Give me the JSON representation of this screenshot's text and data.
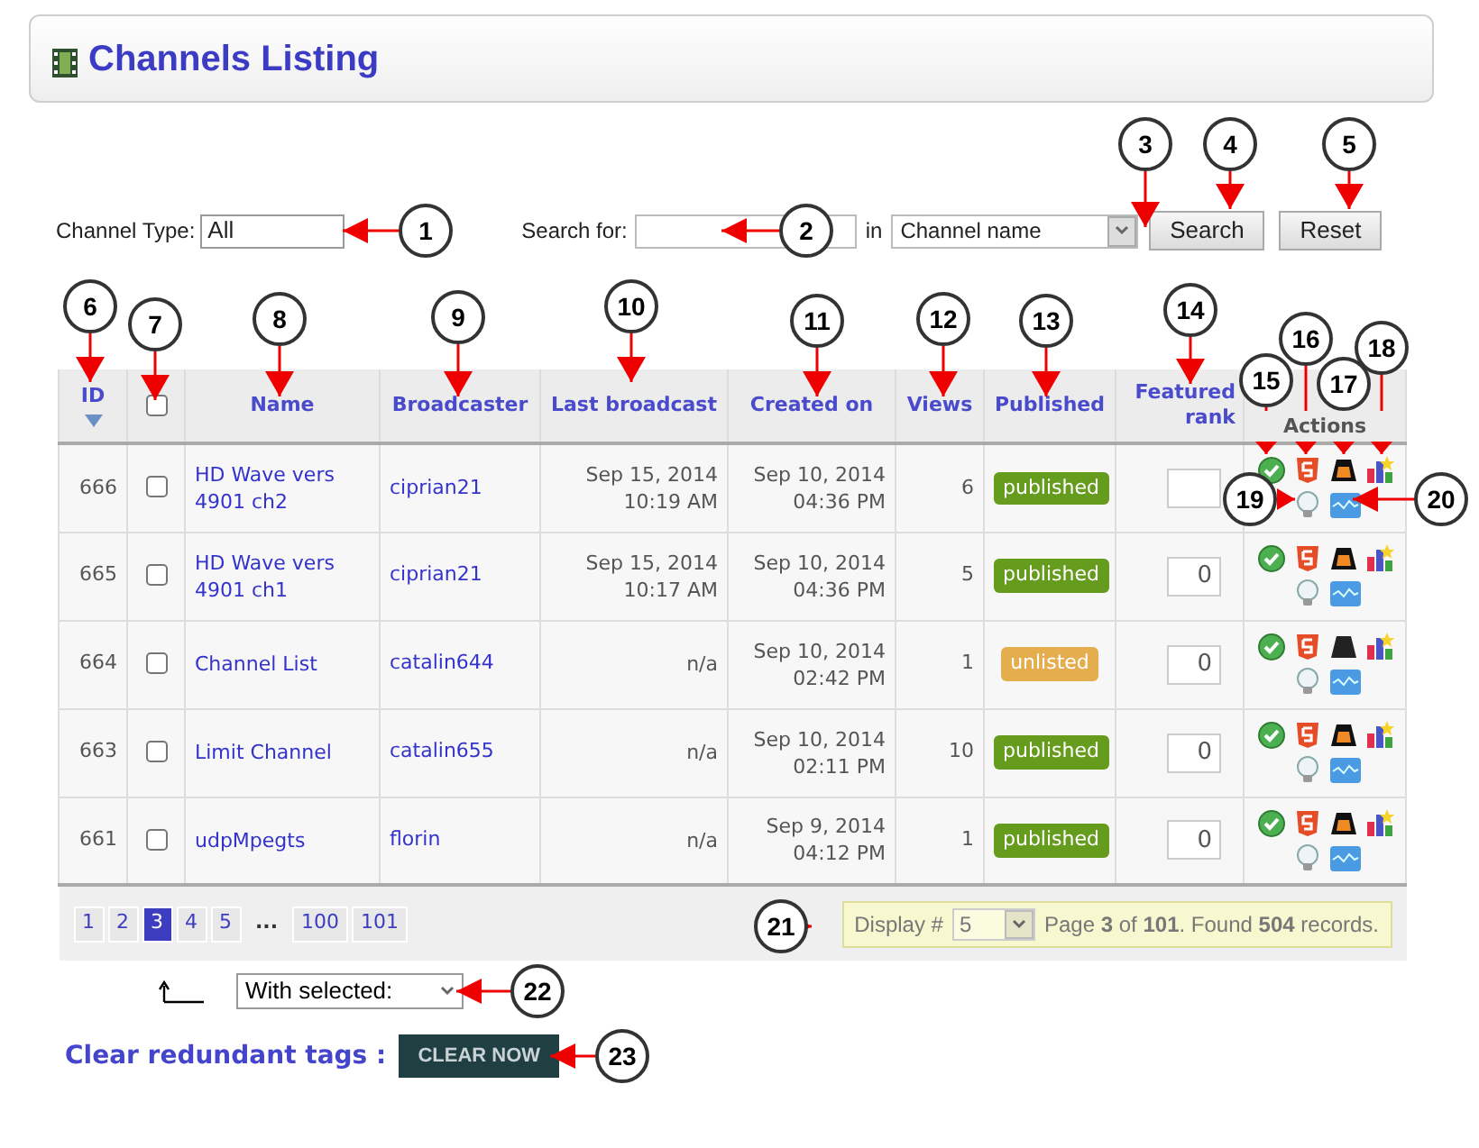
{
  "header": {
    "title": "Channels Listing"
  },
  "filters": {
    "channel_type_label": "Channel Type:",
    "channel_type": "All",
    "search_label": "Search for:",
    "in_label": "in",
    "search_in": "Channel name",
    "search_button": "Search",
    "reset_button": "Reset"
  },
  "table": {
    "columns": [
      {
        "label": "ID",
        "kind": "sort"
      },
      {
        "kind": "checkbox",
        "checked": false
      },
      {
        "label": "Name",
        "kind": "text"
      },
      {
        "label": "Broadcaster",
        "kind": "text"
      },
      {
        "label": "Last broadcast",
        "kind": "text"
      },
      {
        "label": "Created on",
        "kind": "text"
      },
      {
        "label": "Views",
        "kind": "text"
      },
      {
        "label": "Published",
        "kind": "text"
      },
      {
        "label": "Featured rank",
        "kind": "right"
      },
      {
        "label": "Actions",
        "kind": "muted"
      }
    ],
    "rows": [
      {
        "id": "666",
        "checked": false,
        "name": "HD Wave vers 4901 ch2",
        "broadcaster": "ciprian21",
        "last_broadcast": [
          "Sep 15, 2014",
          "10:19 AM"
        ],
        "created_on": [
          "Sep 10, 2014",
          "04:36 PM"
        ],
        "views": "6",
        "status": "published",
        "color": "#669c1e",
        "player_lit": true
      },
      {
        "id": "665",
        "checked": false,
        "name": "HD Wave vers 4901 ch1",
        "broadcaster": "ciprian21",
        "last_broadcast": [
          "Sep 15, 2014",
          "10:17 AM"
        ],
        "created_on": [
          "Sep 10, 2014",
          "04:36 PM"
        ],
        "views": "5",
        "status": "published",
        "color": "#669c1e",
        "rank": "0",
        "player_lit": true
      },
      {
        "id": "664",
        "checked": false,
        "name": "Channel List",
        "broadcaster": "catalin644",
        "last_broadcast": [
          "n/a"
        ],
        "created_on": [
          "Sep 10, 2014",
          "02:42 PM"
        ],
        "views": "1",
        "status": "unlisted",
        "color": "#e4ad4e",
        "rank": "0",
        "player_lit": false
      },
      {
        "id": "663",
        "checked": false,
        "name": "Limit Channel",
        "broadcaster": "catalin655",
        "last_broadcast": [
          "n/a"
        ],
        "created_on": [
          "Sep 10, 2014",
          "02:11 PM"
        ],
        "views": "10",
        "status": "published",
        "color": "#669c1e",
        "rank": "0",
        "player_lit": true
      },
      {
        "id": "661",
        "checked": false,
        "name": "udpMpegts",
        "broadcaster": "florin",
        "last_broadcast": [
          "n/a"
        ],
        "created_on": [
          "Sep 9, 2014",
          "04:12 PM"
        ],
        "views": "1",
        "status": "published",
        "color": "#669c1e",
        "rank": "0",
        "player_lit": true
      }
    ]
  },
  "pagination": {
    "pages": [
      {
        "label": "1",
        "selected": false
      },
      {
        "label": "2",
        "selected": false
      },
      {
        "label": "3",
        "selected": true
      },
      {
        "label": "4",
        "selected": false
      },
      {
        "label": "5",
        "selected": false
      },
      {
        "label": "...",
        "kind": "gap"
      },
      {
        "label": "100",
        "selected": false
      },
      {
        "label": "101",
        "selected": false
      }
    ],
    "display_label": "Display #",
    "display_value": "5",
    "summary": "Page **3** of **101**. Found **504** records."
  },
  "bulk_action": {
    "select": "With selected:"
  },
  "clear_tags": {
    "label": "Clear redundant tags :",
    "button": "CLEAR NOW"
  },
  "callouts": [
    {
      "number": "1"
    },
    {
      "number": "2"
    },
    {
      "number": "3"
    },
    {
      "number": "4"
    },
    {
      "number": "5"
    },
    {
      "number": "6"
    },
    {
      "number": "7"
    },
    {
      "number": "8"
    },
    {
      "number": "9"
    },
    {
      "number": "10"
    },
    {
      "number": "11"
    },
    {
      "number": "12"
    },
    {
      "number": "13"
    },
    {
      "number": "14"
    },
    {
      "number": "15"
    },
    {
      "number": "16"
    },
    {
      "number": "17"
    },
    {
      "number": "18"
    },
    {
      "number": "19"
    },
    {
      "number": "20"
    },
    {
      "number": "21"
    },
    {
      "number": "22"
    },
    {
      "number": "23"
    }
  ]
}
